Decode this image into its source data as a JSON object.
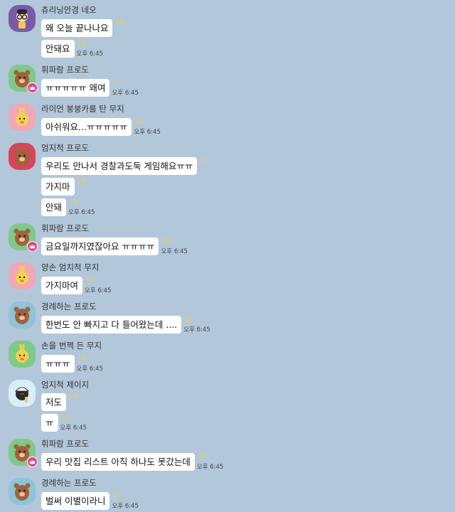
{
  "time_label": "오후 6:45",
  "colors": {
    "background": "#b2c7d9",
    "bubble": "#ffffff",
    "unread": "#f3d13b",
    "crown_badge": "#e8408f"
  },
  "messages": [
    {
      "sender": "츄리닝안경 네오",
      "avatar": "neo-icon",
      "crown": false,
      "lines": [
        {
          "text": "왜 오늘 끝나나요",
          "unread": "16",
          "time": ""
        },
        {
          "text": "안돼요",
          "unread": "16",
          "time": "오후 6:45"
        }
      ]
    },
    {
      "sender": "휘파람 프로도",
      "avatar": "frodo-icon",
      "crown": true,
      "lines": [
        {
          "text": "ㅠㅠㅠㅠㅠ 왜여",
          "unread": "16",
          "time": "오후 6:45"
        }
      ]
    },
    {
      "sender": "라이언 붕붕카를 탄 무지",
      "avatar": "muzi-icon",
      "crown": false,
      "lines": [
        {
          "text": "아쉬워요...ㅠㅠㅠㅠㅠ",
          "unread": "16",
          "time": "오후 6:45"
        }
      ]
    },
    {
      "sender": "엄지척 프로도",
      "avatar": "frodo-icon",
      "crown": false,
      "lines": [
        {
          "text": "우리도 만나서 경찰과도둑 게임해요ㅠㅠ",
          "unread": "16",
          "time": ""
        },
        {
          "text": "가지마",
          "unread": "16",
          "time": ""
        },
        {
          "text": "안돼",
          "unread": "16",
          "time": "오후 6:45"
        }
      ]
    },
    {
      "sender": "휘파람 프로도",
      "avatar": "frodo-icon",
      "crown": true,
      "lines": [
        {
          "text": "금요일까지였잖아요 ㅠㅠㅠㅠ",
          "unread": "16",
          "time": "오후 6:45"
        }
      ]
    },
    {
      "sender": "양손 엄치척 무지",
      "avatar": "muzi-icon",
      "crown": false,
      "lines": [
        {
          "text": "가지마여",
          "unread": "16",
          "time": "오후 6:45"
        }
      ]
    },
    {
      "sender": "경례하는 프로도",
      "avatar": "frodo-icon",
      "crown": false,
      "lines": [
        {
          "text": "한번도 안 빠지고 다 들어왔는데 ....",
          "unread": "16",
          "time": "오후 6:45"
        }
      ]
    },
    {
      "sender": "손을 번쩍 든 무지",
      "avatar": "muzi-icon",
      "crown": false,
      "lines": [
        {
          "text": "ㅠㅠㅠ",
          "unread": "16",
          "time": "오후 6:45"
        }
      ]
    },
    {
      "sender": "엄지척 제이지",
      "avatar": "jayg-icon",
      "crown": false,
      "lines": [
        {
          "text": "저도",
          "unread": "16",
          "time": ""
        },
        {
          "text": "ㅠ",
          "unread": "16",
          "time": "오후 6:45"
        }
      ]
    },
    {
      "sender": "휘파람 프로도",
      "avatar": "frodo-icon",
      "crown": true,
      "lines": [
        {
          "text": "우리 맛집 리스트 아직 하나도 못갔는데",
          "unread": "16",
          "time": "오후 6:45"
        }
      ]
    },
    {
      "sender": "경례하는 프로도",
      "avatar": "frodo-icon",
      "crown": false,
      "lines": [
        {
          "text": "벌써 이별이라니",
          "unread": "16",
          "time": "오후 6:45"
        }
      ]
    }
  ]
}
